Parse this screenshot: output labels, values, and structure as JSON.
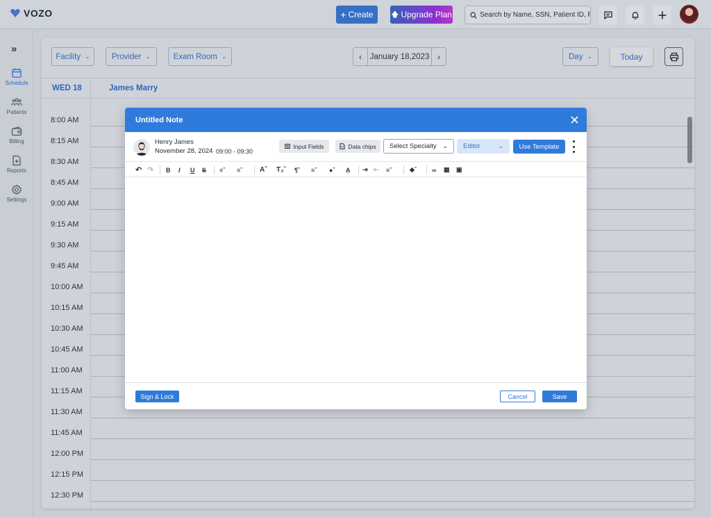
{
  "app": {
    "name": "VOZO"
  },
  "topbar": {
    "create_label": "Create",
    "upgrade_label": "Upgrade Plan",
    "search_placeholder": "Search by Name, SSN, Patient ID, Phone"
  },
  "sidebar": {
    "items": [
      {
        "label": "Schedule",
        "icon": "calendar-icon",
        "active": true
      },
      {
        "label": "Patients",
        "icon": "people-icon"
      },
      {
        "label": "Billing",
        "icon": "wallet-icon"
      },
      {
        "label": "Reports",
        "icon": "report-icon"
      },
      {
        "label": "Settings",
        "icon": "gear-icon"
      }
    ]
  },
  "filters": {
    "facility": "Facility",
    "provider": "Provider",
    "exam_room": "Exam Room",
    "date": "January 18,2023",
    "view": "Day",
    "today": "Today"
  },
  "calendar": {
    "day_label": "WED 18",
    "provider_name": "James Marry",
    "times": [
      "8:00 AM",
      "8:15 AM",
      "8:30 AM",
      "8:45 AM",
      "9:00 AM",
      "9:15 AM",
      "9:30 AM",
      "9:45 AM",
      "10:00 AM",
      "10:15 AM",
      "10:30 AM",
      "10:45 AM",
      "11:00 AM",
      "11:15 AM",
      "11:30 AM",
      "11:45 AM",
      "12:00 PM",
      "12:15 PM",
      "12:30 PM"
    ]
  },
  "modal": {
    "title": "Untitled Note",
    "patient_name": "Henry James",
    "patient_date": "November 28, 2024",
    "patient_time": "09:00 - 09:30",
    "input_fields_label": "Input Fields",
    "data_chips_label": "Data chips",
    "specialty_placeholder": "Select Specialty",
    "editor_label": "Editor",
    "use_template_label": "Use Template",
    "sign_lock_label": "Sign & Lock",
    "cancel_label": "Cancel",
    "save_label": "Save"
  },
  "colors": {
    "primary": "#2f7bdc",
    "accent_text": "#2e66b8",
    "upgrade_gradient_start": "#3564b8",
    "upgrade_gradient_end": "#b437c6"
  }
}
